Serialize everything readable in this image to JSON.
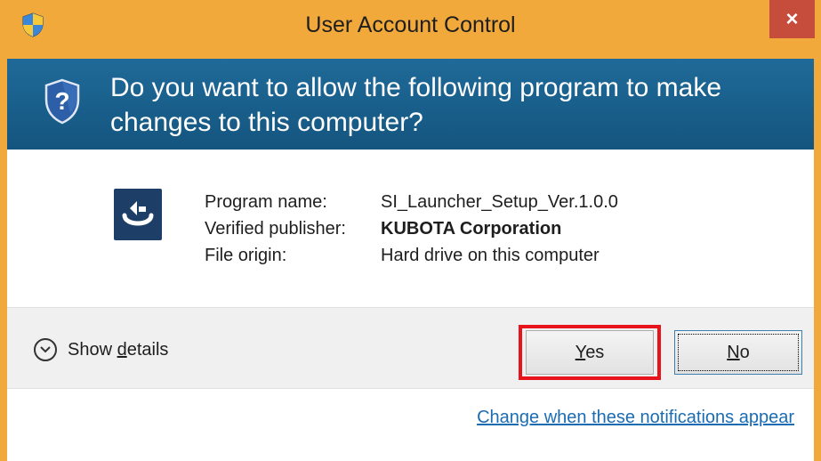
{
  "window": {
    "title": "User Account Control",
    "close_label": "×"
  },
  "header": {
    "question": "Do you want to allow the following program to make changes to this computer?"
  },
  "details": {
    "program_name_label": "Program name:",
    "program_name_value": "SI_Launcher_Setup_Ver.1.0.0",
    "publisher_label": "Verified publisher:",
    "publisher_value": "KUBOTA Corporation",
    "origin_label": "File origin:",
    "origin_value": "Hard drive on this computer"
  },
  "buttons": {
    "show_details_pre": "Show ",
    "show_details_mnemonic": "d",
    "show_details_post": "etails",
    "yes_mnemonic": "Y",
    "yes_rest": "es",
    "no_mnemonic": "N",
    "no_rest": "o"
  },
  "footer": {
    "change_notifications_link": "Change when these notifications appear"
  },
  "colors": {
    "frame": "#f2a93b",
    "header": "#1a5e8a",
    "close_button": "#c64c3c",
    "highlight": "#e8141c",
    "link": "#1c6cb3"
  }
}
